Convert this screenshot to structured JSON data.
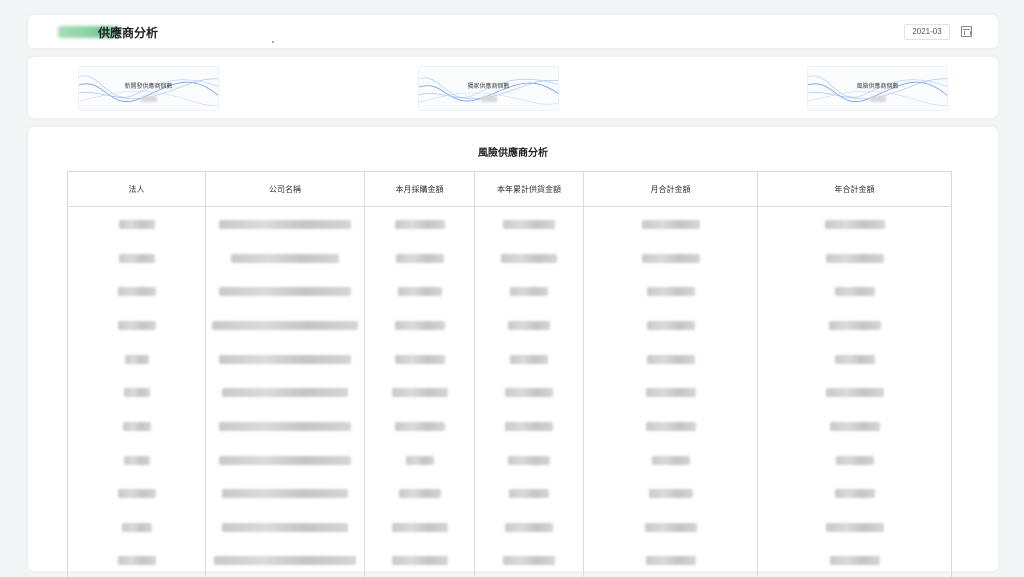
{
  "header": {
    "title": "供應商分析",
    "date_value": "2021-03"
  },
  "stats": [
    {
      "label": "新開發供應商個數"
    },
    {
      "label": "獨家供應商個數"
    },
    {
      "label": "風險供應商個數"
    }
  ],
  "table": {
    "title": "風險供應商分析",
    "columns": [
      "法人",
      "公司名稱",
      "本月採購金額",
      "本年累計供貨金額",
      "月合計金額",
      "年合計金額"
    ]
  },
  "colors": {
    "background": "#f4f5f7",
    "card": "#ffffff",
    "wave_primary": "#6f9de8",
    "wave_secondary": "#b9d2f5",
    "logo_green": "#7cc99a"
  }
}
